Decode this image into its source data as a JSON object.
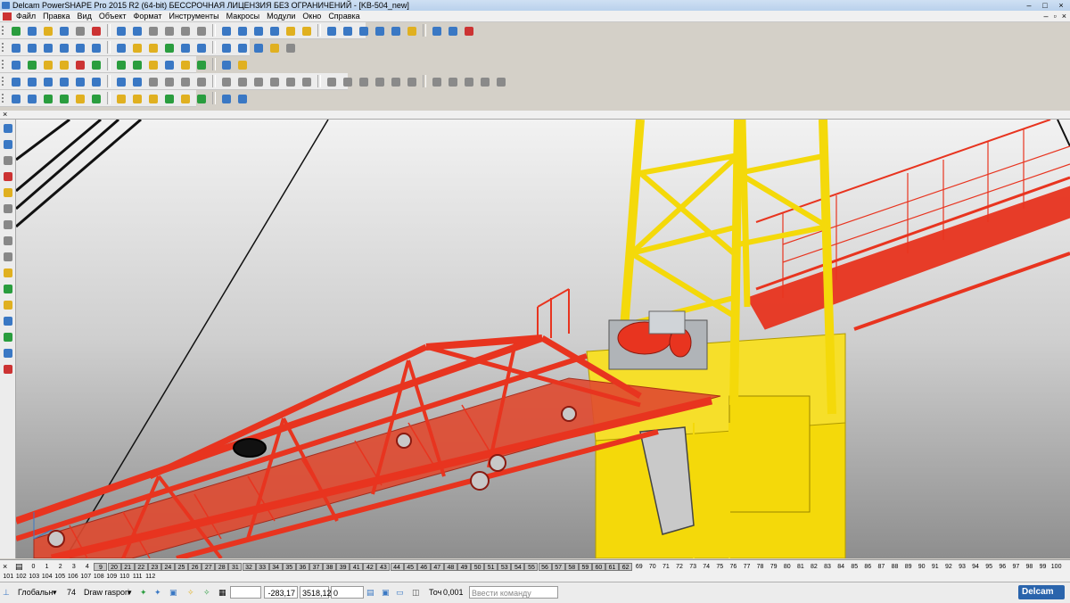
{
  "window": {
    "title": "Delcam PowerSHAPE Pro 2015 R2 (64-bit) БЕССРОЧНАЯ ЛИЦЕНЗИЯ БЕЗ ОГРАНИЧЕНИЙ - [KB-504_new]",
    "minimize": "–",
    "maximize": "□",
    "close": "×"
  },
  "menu": [
    "Файл",
    "Правка",
    "Вид",
    "Объект",
    "Формат",
    "Инструменты",
    "Макросы",
    "Модули",
    "Окно",
    "Справка"
  ],
  "mdi_controls": [
    "–",
    "▫",
    "×"
  ],
  "toolbars": {
    "row1": [
      "#2a9d3e",
      "#3a78c4",
      "#e0b020",
      "#3a78c4",
      "#888888",
      "#cc3333",
      "#3a78c4",
      "#3a78c4",
      "#8a8a8a",
      "#8a8a8a",
      "#8a8a8a",
      "#8a8a8a",
      "#3a78c4",
      "#3a78c4",
      "#3a78c4",
      "#3a78c4",
      "#e0b020",
      "#e0b020",
      "#3a78c4",
      "#3a78c4",
      "#3a78c4",
      "#3a78c4",
      "#3a78c4",
      "#e0b020",
      "#3a78c4",
      "#3a78c4",
      "#cc3333"
    ],
    "row2": [
      "#3a78c4",
      "#3a78c4",
      "#3a78c4",
      "#3a78c4",
      "#3a78c4",
      "#3a78c4",
      "#3a78c4",
      "#e0b020",
      "#e0b020",
      "#2a9d3e",
      "#3a78c4",
      "#3a78c4",
      "#3a78c4",
      "#3a78c4",
      "#3a78c4",
      "#e0b020",
      "#8a8a8a"
    ],
    "row3": [
      "#3a78c4",
      "#2a9d3e",
      "#e0b020",
      "#e0b020",
      "#cc3333",
      "#2a9d3e",
      "#2a9d3e",
      "#2a9d3e",
      "#e0b020",
      "#3a78c4",
      "#e0b020",
      "#2a9d3e",
      "#3a78c4",
      "#e0b020"
    ],
    "row4": [
      "#3a78c4",
      "#3a78c4",
      "#3a78c4",
      "#3a78c4",
      "#3a78c4",
      "#3a78c4",
      "#3a78c4",
      "#3a78c4",
      "#8a8a8a",
      "#8a8a8a",
      "#8a8a8a",
      "#8a8a8a",
      "#8a8a8a",
      "#8a8a8a",
      "#8a8a8a",
      "#8a8a8a",
      "#8a8a8a",
      "#8a8a8a",
      "#8a8a8a",
      "#8a8a8a",
      "#8a8a8a",
      "#8a8a8a",
      "#8a8a8a",
      "#8a8a8a",
      "#8a8a8a",
      "#8a8a8a",
      "#8a8a8a",
      "#8a8a8a",
      "#8a8a8a"
    ],
    "row5": [
      "#3a78c4",
      "#3a78c4",
      "#2a9d3e",
      "#2a9d3e",
      "#e0b020",
      "#2a9d3e",
      "#e0b020",
      "#e0b020",
      "#e0b020",
      "#2a9d3e",
      "#e0b020",
      "#2a9d3e",
      "#3a78c4",
      "#3a78c4"
    ]
  },
  "left_toolbar": [
    "#3a78c4",
    "#3a78c4",
    "#888888",
    "#cc3333",
    "#e0b020",
    "#888888",
    "#888888",
    "#888888",
    "#888888",
    "#e0b020",
    "#2a9d3e",
    "#e0b020",
    "#3a78c4",
    "#2a9d3e",
    "#3a78c4",
    "#cc3333"
  ],
  "levels": {
    "row1": [
      "0",
      "1",
      "2",
      "3",
      "4",
      "9",
      "20",
      "21",
      "22",
      "23",
      "24",
      "25",
      "26",
      "27",
      "28",
      "31",
      "32",
      "33",
      "34",
      "35",
      "36",
      "37",
      "38",
      "39",
      "41",
      "42",
      "43",
      "44",
      "45",
      "46",
      "47",
      "48",
      "49",
      "50",
      "51",
      "53",
      "54",
      "55",
      "56",
      "57",
      "58",
      "59",
      "60",
      "61",
      "62",
      "69",
      "70",
      "71",
      "72",
      "73",
      "74",
      "75",
      "76",
      "77",
      "78",
      "79",
      "80",
      "81",
      "82",
      "83",
      "84",
      "85",
      "86",
      "87",
      "88",
      "89",
      "90",
      "91",
      "92",
      "93",
      "94",
      "95",
      "96",
      "97",
      "98",
      "99",
      "100"
    ],
    "row1_on_from": 5,
    "row1_on_to": 44,
    "row2": [
      "101",
      "102",
      "103",
      "104",
      "105",
      "106",
      "107",
      "108",
      "109",
      "110",
      "111",
      "112"
    ]
  },
  "status": {
    "workplane": "Глобальн",
    "level_number": "74",
    "level_name": "Draw raspori",
    "coord_x": "-283,17",
    "coord_y": "3518,12",
    "coord_z": "0",
    "tolerance_label": "Точ",
    "tolerance_value": "0,001",
    "command_placeholder": "Ввести команду",
    "brand": "Delcam"
  },
  "scene": {
    "boom_color": "#e8341f",
    "tower_color": "#f4d90a",
    "cable_color": "#111111",
    "winch_color": "#b0b4b8"
  }
}
